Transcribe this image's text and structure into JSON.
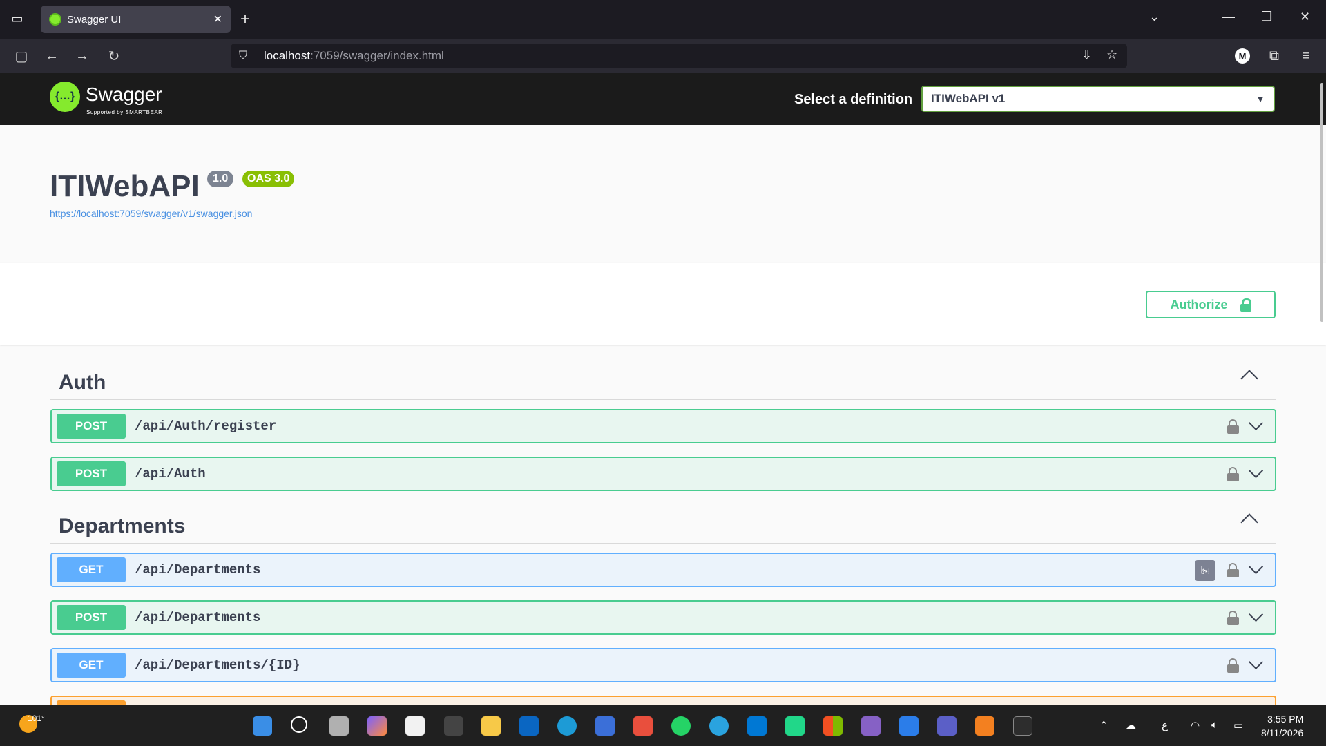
{
  "browser": {
    "tab_title": "Swagger UI",
    "url_host": "localhost",
    "url_path": ":7059/swagger/index.html",
    "avatar_letter": "M"
  },
  "topbar": {
    "logo_text": "Swagger",
    "logo_sub": "Supported by SMARTBEAR",
    "definition_label": "Select a definition",
    "definition_value": "ITIWebAPI v1"
  },
  "info": {
    "title": "ITIWebAPI",
    "version": "1.0",
    "oas": "OAS 3.0",
    "spec_url": "https://localhost:7059/swagger/v1/swagger.json"
  },
  "authorize_label": "Authorize",
  "tags": [
    {
      "name": "Auth",
      "operations": [
        {
          "method": "POST",
          "path": "/api/Auth/register"
        },
        {
          "method": "POST",
          "path": "/api/Auth"
        }
      ]
    },
    {
      "name": "Departments",
      "operations": [
        {
          "method": "GET",
          "path": "/api/Departments"
        },
        {
          "method": "POST",
          "path": "/api/Departments"
        },
        {
          "method": "GET",
          "path": "/api/Departments/{ID}"
        }
      ]
    }
  ],
  "taskbar": {
    "weather_temp": "101°",
    "time": "3:55 PM",
    "date": "8/11/2026",
    "lang": "ع"
  },
  "colors": {
    "post": "#49cc90",
    "get": "#61affe",
    "swagger_green": "#85ea2d"
  }
}
